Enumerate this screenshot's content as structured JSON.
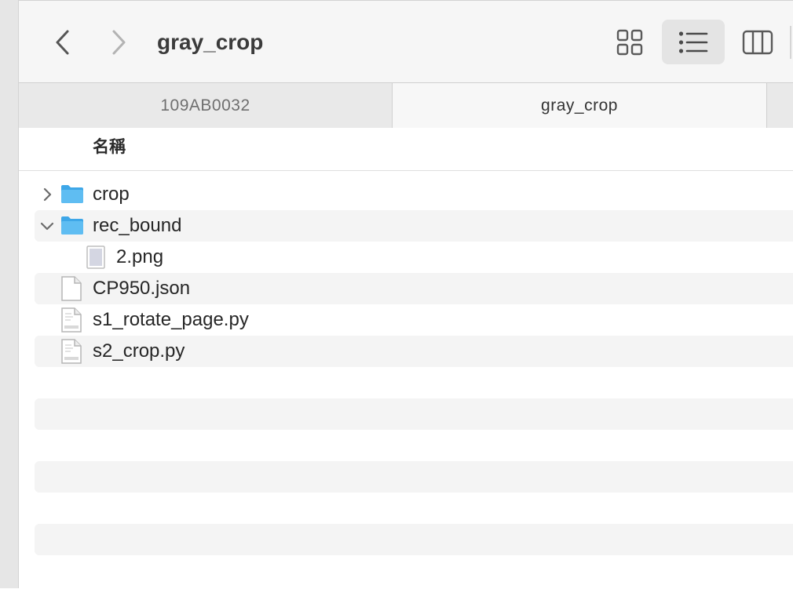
{
  "window": {
    "title": "gray_crop"
  },
  "toolbar": {
    "back_icon": "chevron-left-icon",
    "forward_icon": "chevron-right-icon",
    "views": [
      {
        "icon": "grid-view-icon",
        "active": false
      },
      {
        "icon": "list-view-icon",
        "active": true
      },
      {
        "icon": "column-view-icon",
        "active": false
      }
    ]
  },
  "tabs": [
    {
      "label": "109AB0032",
      "active": false
    },
    {
      "label": "gray_crop",
      "active": true
    }
  ],
  "columns": {
    "name": "名稱"
  },
  "files": [
    {
      "name": "crop",
      "type": "folder",
      "expanded": false
    },
    {
      "name": "rec_bound",
      "type": "folder",
      "expanded": true
    },
    {
      "name": "2.png",
      "type": "image"
    },
    {
      "name": "CP950.json",
      "type": "document"
    },
    {
      "name": "s1_rotate_page.py",
      "type": "python"
    },
    {
      "name": "s2_crop.py",
      "type": "python"
    }
  ],
  "colors": {
    "folder": "#4fb4ef",
    "active_view_bg": "#e4e4e4",
    "stripe": "#f4f4f4"
  }
}
